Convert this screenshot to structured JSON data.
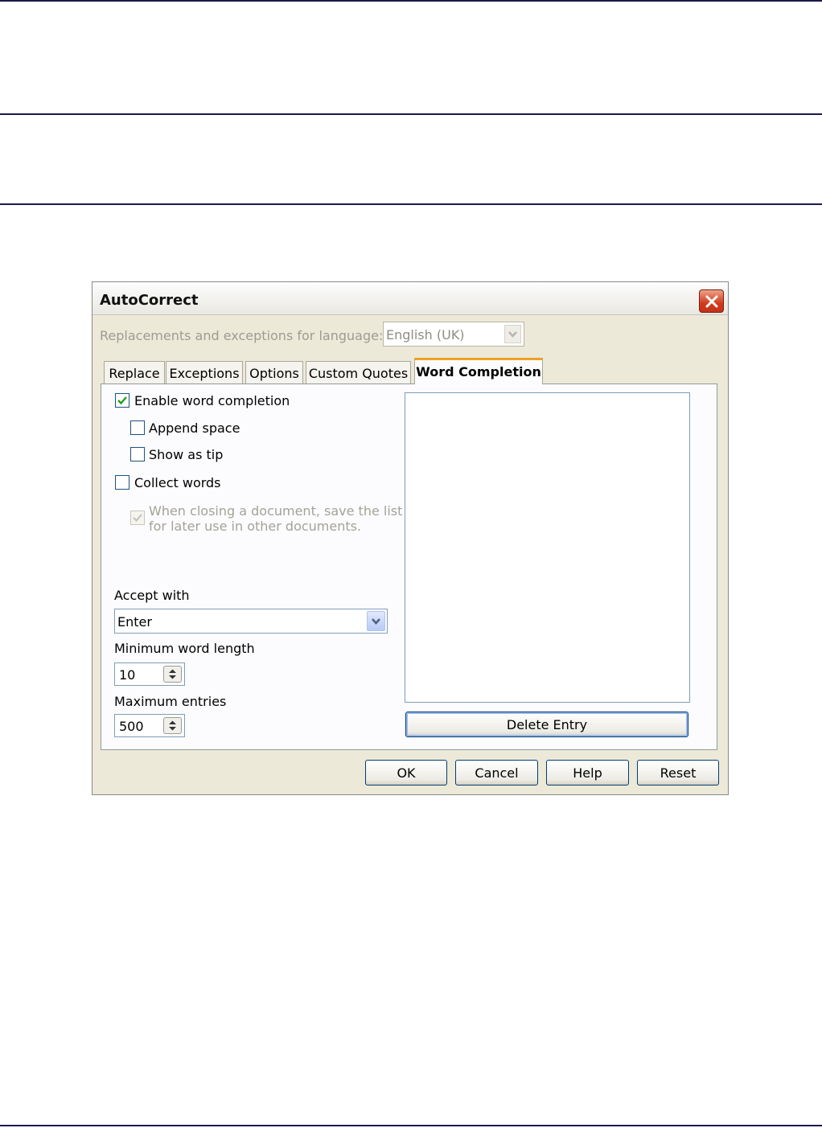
{
  "dialog": {
    "title": "AutoCorrect",
    "language_label": "Replacements and exceptions for language:",
    "language_value": "English (UK)",
    "tabs": [
      {
        "label": "Replace"
      },
      {
        "label": "Exceptions"
      },
      {
        "label": "Options"
      },
      {
        "label": "Custom Quotes"
      },
      {
        "label": "Word Completion"
      }
    ],
    "active_tab": "Word Completion",
    "options": {
      "enable_word_completion": {
        "label": "Enable word completion",
        "checked": true
      },
      "append_space": {
        "label": "Append space",
        "checked": false
      },
      "show_as_tip": {
        "label": "Show as tip",
        "checked": false
      },
      "collect_words": {
        "label": "Collect words",
        "checked": false
      },
      "save_list": {
        "label_line1": "When closing a document, save the list",
        "label_line2": "for later use in other documents.",
        "checked": true,
        "disabled": true
      }
    },
    "accept_with": {
      "label": "Accept with",
      "value": "Enter"
    },
    "min_word_length": {
      "label": "Minimum word length",
      "value": "10"
    },
    "max_entries": {
      "label": "Maximum entries",
      "value": "500"
    },
    "delete_entry_label": "Delete Entry",
    "buttons": {
      "ok": "OK",
      "cancel": "Cancel",
      "help": "Help",
      "reset": "Reset"
    },
    "colors": {
      "active_tab_accent": "#f0a020",
      "close_button": "#d23b1b",
      "rule": "#1a1a4a"
    }
  }
}
